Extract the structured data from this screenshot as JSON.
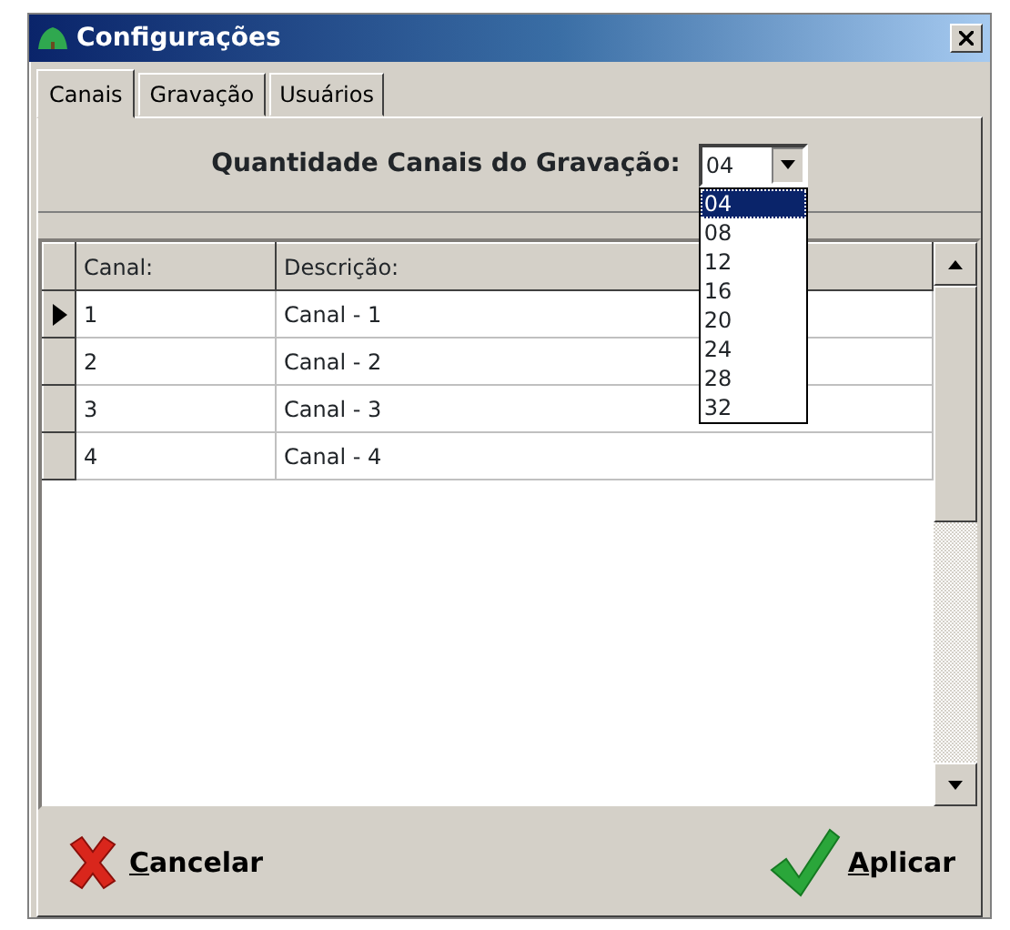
{
  "window": {
    "title": "Configurações"
  },
  "tabs": [
    {
      "label": "Canais",
      "selected": true
    },
    {
      "label": "Gravação",
      "selected": false
    },
    {
      "label": "Usuários",
      "selected": false
    }
  ],
  "quantity": {
    "label": "Quantidade Canais do Gravação:",
    "value": "04",
    "expanded": true,
    "options": [
      {
        "label": "04",
        "selected": true
      },
      {
        "label": "08",
        "selected": false
      },
      {
        "label": "12",
        "selected": false
      },
      {
        "label": "16",
        "selected": false
      },
      {
        "label": "20",
        "selected": false
      },
      {
        "label": "24",
        "selected": false
      },
      {
        "label": "28",
        "selected": false
      },
      {
        "label": "32",
        "selected": false
      }
    ]
  },
  "table": {
    "columns": [
      "Canal:",
      "Descrição:"
    ],
    "rows": [
      {
        "cells": [
          "1",
          "Canal - 1"
        ],
        "selected": true
      },
      {
        "cells": [
          "2",
          "Canal - 2"
        ],
        "selected": false
      },
      {
        "cells": [
          "3",
          "Canal - 3"
        ],
        "selected": false
      },
      {
        "cells": [
          "4",
          "Canal - 4"
        ],
        "selected": false
      }
    ]
  },
  "buttons": [
    {
      "label": "Cancelar",
      "kind": "cancel"
    },
    {
      "label": "Aplicar",
      "kind": "apply"
    }
  ]
}
